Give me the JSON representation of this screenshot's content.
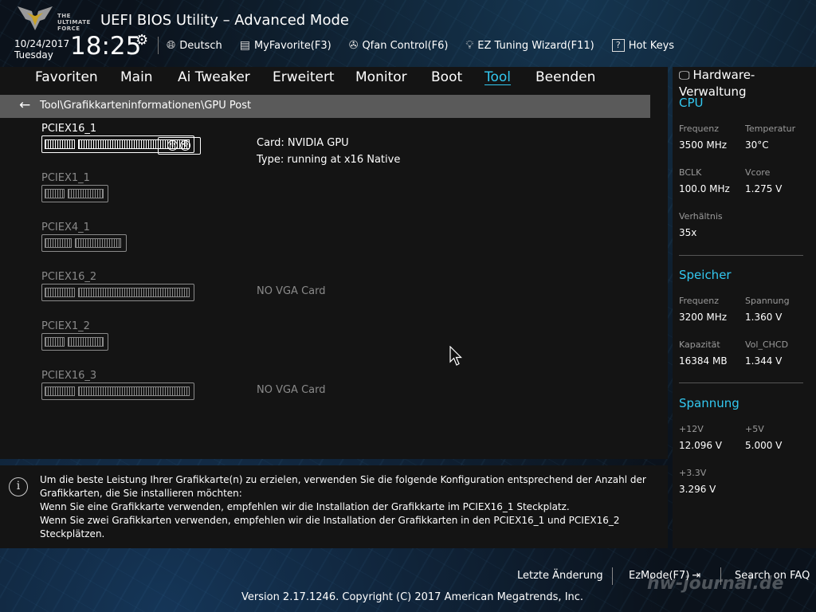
{
  "header": {
    "logo_text": "THE ULTIMATE FORCE",
    "title": "UEFI BIOS Utility – Advanced Mode",
    "date": "10/24/2017",
    "day": "Tuesday",
    "time": "18:25",
    "toolbar": [
      {
        "icon": "globe-icon",
        "label": "Deutsch"
      },
      {
        "icon": "favorite-icon",
        "label": "MyFavorite(F3)"
      },
      {
        "icon": "fan-icon",
        "label": "Qfan Control(F6)"
      },
      {
        "icon": "lightbulb-icon",
        "label": "EZ Tuning Wizard(F11)"
      },
      {
        "icon": "question-icon",
        "label": "Hot Keys"
      }
    ]
  },
  "nav": {
    "items": [
      "Favoriten",
      "Main",
      "Ai Tweaker",
      "Erweitert",
      "Monitor",
      "Boot",
      "Tool",
      "Beenden"
    ],
    "active": "Tool",
    "active_color": "#33c8f0"
  },
  "breadcrumb": "Tool\\Grafikkarteninformationen\\GPU Post",
  "slots": [
    {
      "name": "PCIEX16_1",
      "card": "Card: NVIDIA GPU",
      "type": "Type: running at x16 Native"
    },
    {
      "name": "PCIEX1_1"
    },
    {
      "name": "PCIEX4_1"
    },
    {
      "name": "PCIEX16_2",
      "status": "NO VGA Card"
    },
    {
      "name": "PCIEX1_2"
    },
    {
      "name": "PCIEX16_3",
      "status": "NO VGA Card"
    }
  ],
  "info": {
    "line1": "Um die beste Leistung Ihrer Grafikkarte(n) zu erzielen, verwenden Sie die folgende Konfiguration entsprechend der Anzahl der",
    "line2": "Grafikkarten, die Sie installieren möchten:",
    "line3": "Wenn Sie eine Grafikkarte verwenden, empfehlen wir die Installation der Grafikkarte im PCIEX16_1 Steckplatz.",
    "line4": "Wenn Sie zwei Grafikkarten verwenden, empfehlen wir die Installation der Grafikkarten in den PCIEX16_1 und PCIEX16_2 Steckplätzen."
  },
  "hardware": {
    "title": "Hardware-Verwaltung",
    "cpu": {
      "heading": "CPU",
      "freq_label": "Frequenz",
      "freq": "3500 MHz",
      "temp_label": "Temperatur",
      "temp": "30°C",
      "bclk_label": "BCLK",
      "bclk": "100.0 MHz",
      "vcore_label": "Vcore",
      "vcore": "1.275 V",
      "ratio_label": "Verhältnis",
      "ratio": "35x"
    },
    "memory": {
      "heading": "Speicher",
      "freq_label": "Frequenz",
      "freq": "3200 MHz",
      "volt_label": "Spannung",
      "volt": "1.360 V",
      "cap_label": "Kapazität",
      "cap": "16384 MB",
      "chcd_label": "Vol_CHCD",
      "chcd": "1.344 V"
    },
    "voltage": {
      "heading": "Spannung",
      "v12_label": "+12V",
      "v12": "12.096 V",
      "v5_label": "+5V",
      "v5": "5.000 V",
      "v33_label": "+3.3V",
      "v33": "3.296 V"
    }
  },
  "footer": {
    "last_change": "Letzte Änderung",
    "ezmode": "EzMode(F7)",
    "search": "Search on FAQ",
    "version": "Version 2.17.1246. Copyright (C) 2017 American Megatrends, Inc.",
    "watermark": "hw-journal.de"
  }
}
